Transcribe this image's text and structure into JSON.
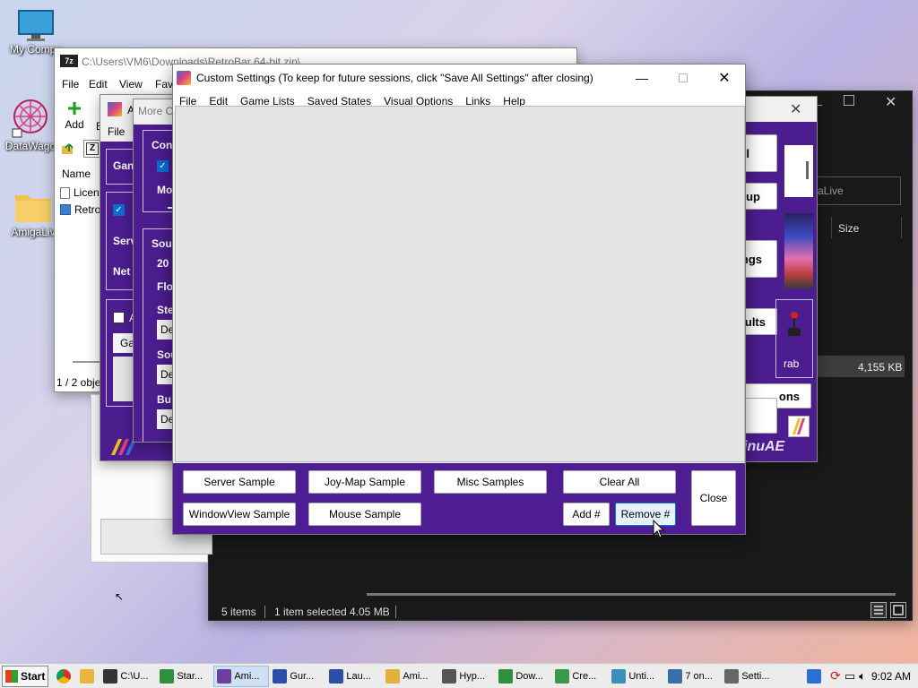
{
  "desktop": {
    "icons": [
      {
        "label": "My Compu",
        "icon": "monitor-icon"
      },
      {
        "label": "DataWago",
        "icon": "datawagon-icon"
      },
      {
        "label": "AmigaLiv",
        "icon": "folder-icon"
      }
    ]
  },
  "explorer_7z": {
    "title": "C:\\Users\\VM6\\Downloads\\RetroBar 64-bit.zip\\",
    "app_badge": "7z",
    "menu": [
      "File",
      "Edit",
      "View",
      "Favo"
    ],
    "toolbar": {
      "add_label": "Add",
      "extract_label": "E"
    },
    "address_prefix": "Z",
    "column_name": "Name",
    "files": [
      "Licen",
      "Retro"
    ],
    "status": "1 / 2 obje"
  },
  "dark_explorer": {
    "search_placeholder": "aLive",
    "column_size": "Size",
    "selected_size": "4,155 KB",
    "status_items": "5 items",
    "status_selected": "1 item selected",
    "status_size": "4.05 MB"
  },
  "winuae_window": {
    "title": "A",
    "menu_file": "File",
    "labels": [
      "Gan",
      "Serv",
      "Net"
    ],
    "checkbox_label": "A",
    "combo_value": "Ga"
  },
  "more_options": {
    "title": "More O",
    "labels": [
      "Con",
      "Mo",
      "Sou",
      "20",
      "Flo",
      "Ste",
      "De",
      "Sou",
      "De",
      "Bu",
      "De"
    ]
  },
  "launcher_window": {
    "buttons": [
      "l",
      "up",
      "ngs",
      "ults",
      "ons"
    ],
    "label_grab": "rab",
    "logo_text": "inuAE"
  },
  "custom_settings": {
    "title": "Custom Settings (To keep for future sessions, click \"Save All Settings\" after closing)",
    "menu": [
      "File",
      "Edit",
      "Game Lists",
      "Saved States",
      "Visual Options",
      "Links",
      "Help"
    ],
    "buttons": {
      "server_sample": "Server Sample",
      "joymap_sample": "Joy-Map Sample",
      "misc_samples": "Misc Samples",
      "clear_all": "Clear All",
      "windowview_sample": "WindowView Sample",
      "mouse_sample": "Mouse Sample",
      "add_num": "Add #",
      "remove_num": "Remove #",
      "close": "Close"
    }
  },
  "taskbar": {
    "start": "Start",
    "items": [
      {
        "label": "C:\\U...",
        "icon": "7z-icon",
        "color": "#333333"
      },
      {
        "label": "Star...",
        "icon": "chrome-icon",
        "color": "#2f8f3d"
      },
      {
        "label": "Ami...",
        "icon": "amiga-icon",
        "color": "#6b3fa0",
        "active": true
      },
      {
        "label": "Gur...",
        "icon": "gurgle-icon",
        "color": "#2c4ea8"
      },
      {
        "label": "Lau...",
        "icon": "launcher-icon",
        "color": "#2c4ea8"
      },
      {
        "label": "Ami...",
        "icon": "folder-icon",
        "color": "#e2b33b"
      },
      {
        "label": "Hyp...",
        "icon": "hyper-icon",
        "color": "#555555"
      },
      {
        "label": "Dow...",
        "icon": "download-icon",
        "color": "#2f8f3d"
      },
      {
        "label": "Cre...",
        "icon": "create-icon",
        "color": "#3a9a4a"
      },
      {
        "label": "Unti...",
        "icon": "untitled-icon",
        "color": "#3a8fb8"
      },
      {
        "label": "7 on...",
        "icon": "computer-icon",
        "color": "#3a6ea8"
      },
      {
        "label": "Setti...",
        "icon": "settings-icon",
        "color": "#666666"
      }
    ],
    "clock": "9:02 AM"
  }
}
